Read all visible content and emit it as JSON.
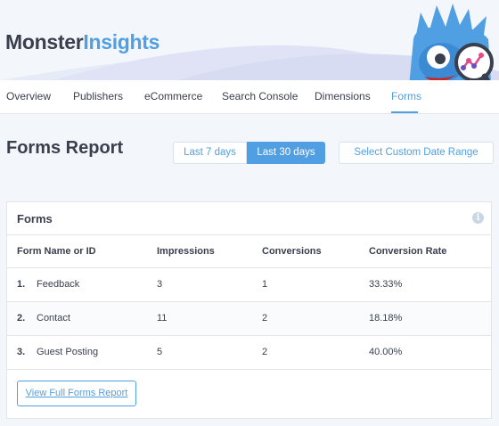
{
  "brand": {
    "part1": "Monster",
    "part2": "Insights",
    "accent": "#509fe2",
    "dark": "#393f4c"
  },
  "nav": {
    "tabs": [
      {
        "label": "Overview"
      },
      {
        "label": "Publishers"
      },
      {
        "label": "eCommerce"
      },
      {
        "label": "Search Console"
      },
      {
        "label": "Dimensions"
      },
      {
        "label": "Forms"
      }
    ],
    "active": "Forms"
  },
  "report": {
    "title": "Forms Report"
  },
  "date_range": {
    "options": [
      "Last 7 days",
      "Last 30 days"
    ],
    "selected": "Last 30 days",
    "custom_label": "Select Custom Date Range"
  },
  "forms_card": {
    "title": "Forms",
    "info_icon": "info-icon",
    "columns": [
      "Form Name or ID",
      "Impressions",
      "Conversions",
      "Conversion Rate"
    ],
    "rows": [
      {
        "num": "1.",
        "name": "Feedback",
        "impressions": "3",
        "conversions": "1",
        "rate": "33.33%"
      },
      {
        "num": "2.",
        "name": "Contact",
        "impressions": "11",
        "conversions": "2",
        "rate": "18.18%"
      },
      {
        "num": "3.",
        "name": "Guest Posting",
        "impressions": "5",
        "conversions": "2",
        "rate": "40.00%"
      }
    ],
    "view_button": "View Full Forms Report"
  }
}
